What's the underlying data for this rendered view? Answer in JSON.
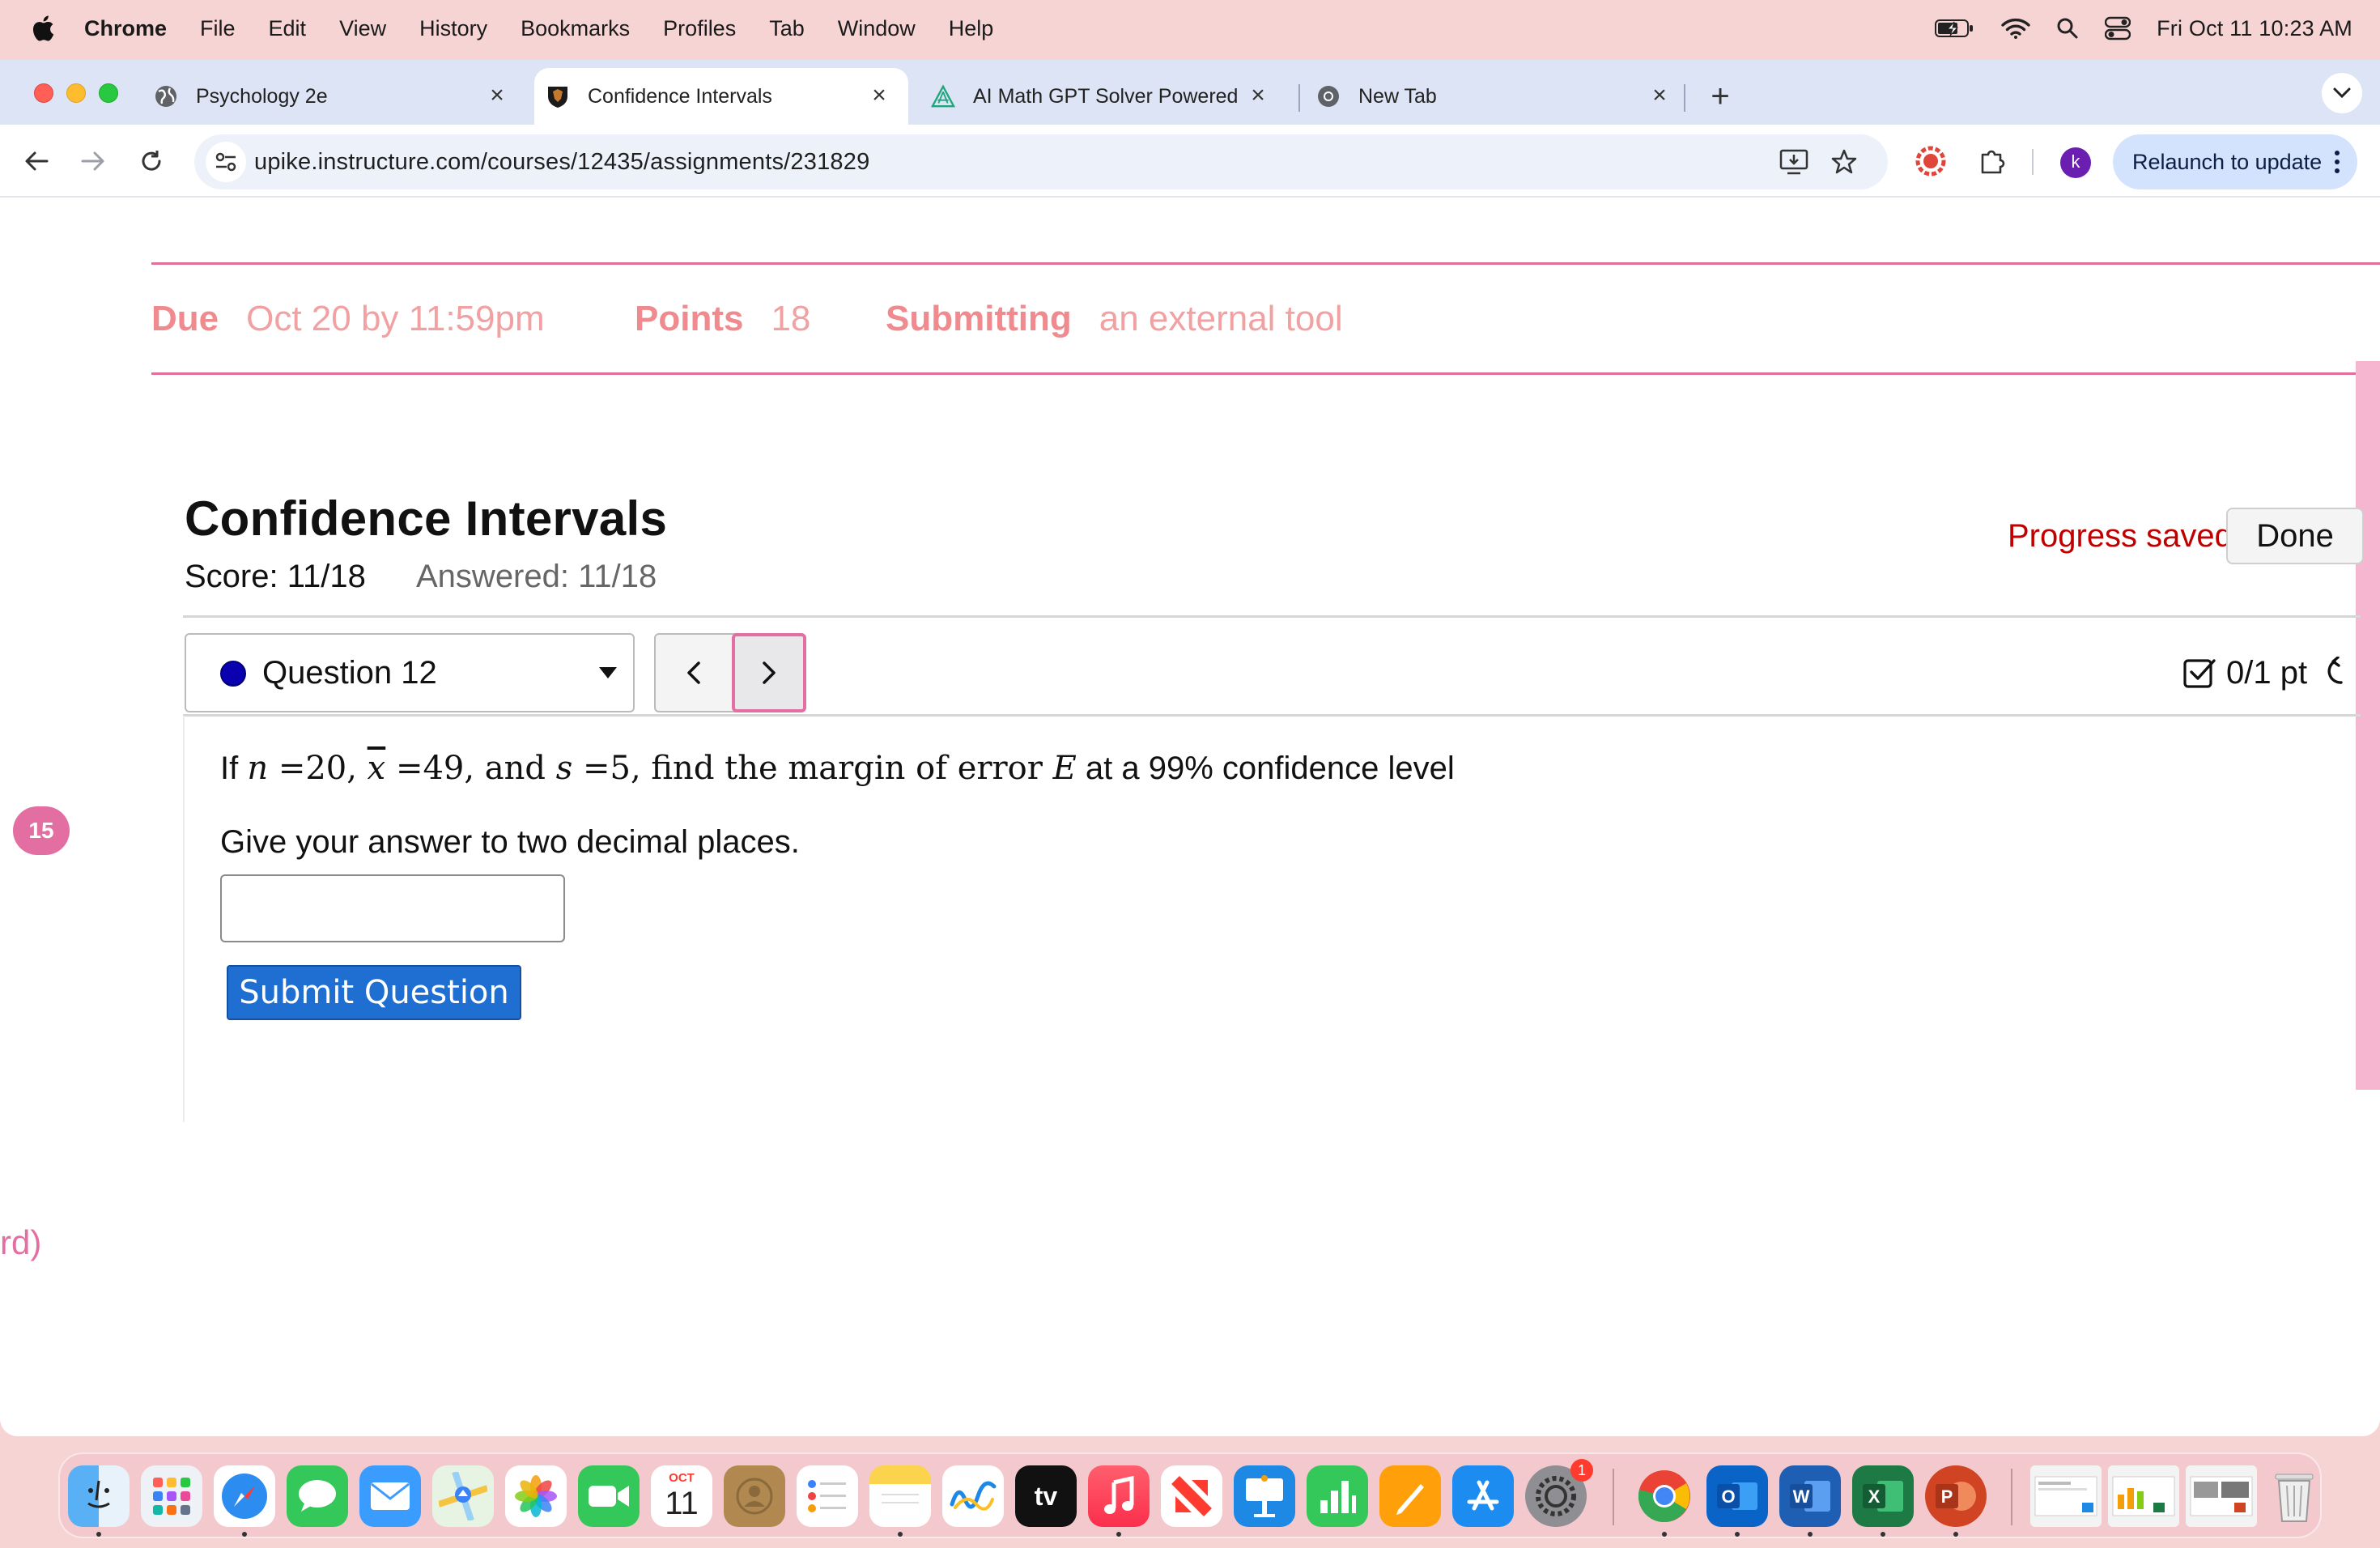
{
  "menubar": {
    "app_name": "Chrome",
    "items": [
      "File",
      "Edit",
      "View",
      "History",
      "Bookmarks",
      "Profiles",
      "Tab",
      "Window",
      "Help"
    ],
    "clock": "Fri Oct 11  10:23 AM"
  },
  "browser": {
    "tabs": [
      {
        "title": "Psychology 2e",
        "favicon": "globe-icon"
      },
      {
        "title": "Confidence Intervals",
        "favicon": "pike-shield-icon"
      },
      {
        "title": "AI Math GPT Solver Powered",
        "favicon": "ai-math-icon"
      },
      {
        "title": "New Tab",
        "favicon": "chrome-icon"
      }
    ],
    "url": "upike.instructure.com/courses/12435/assignments/231829",
    "relaunch_label": "Relaunch to update",
    "avatar_letter": "k"
  },
  "assignment": {
    "due_label": "Due",
    "due_value": "Oct 20 by 11:59pm",
    "points_label": "Points",
    "points_value": "18",
    "submitting_label": "Submitting",
    "submitting_value": "an external tool"
  },
  "side": {
    "badge": "15",
    "fragment": "rd)"
  },
  "quiz": {
    "title": "Confidence Intervals",
    "score": "Score: 11/18",
    "answered": "Answered: 11/18",
    "progress_status": "Progress saved",
    "done_label": "Done",
    "question_selector": "Question 12",
    "points": "0/1 pt",
    "question": {
      "t1": "If ",
      "n_sym": "n",
      "n_val": " =20, ",
      "x_sym": "x",
      "x_val": " =49, and ",
      "s_sym": "s",
      "s_val": " =5, find the margin of error ",
      "e_sym": "E",
      "tail": " at a 99% confidence level"
    },
    "instruction": "Give your answer to two decimal places.",
    "answer_value": "",
    "submit_label": "Submit Question"
  },
  "dock": {
    "calendar_month": "OCT",
    "calendar_day": "11",
    "settings_badge": "1",
    "tv_label": "tv"
  },
  "colors": {
    "accent_pink": "#e36fa2",
    "details_label": "#ef8a8f",
    "progress_saved": "#c00000",
    "submit_blue": "#1f6fd3"
  }
}
